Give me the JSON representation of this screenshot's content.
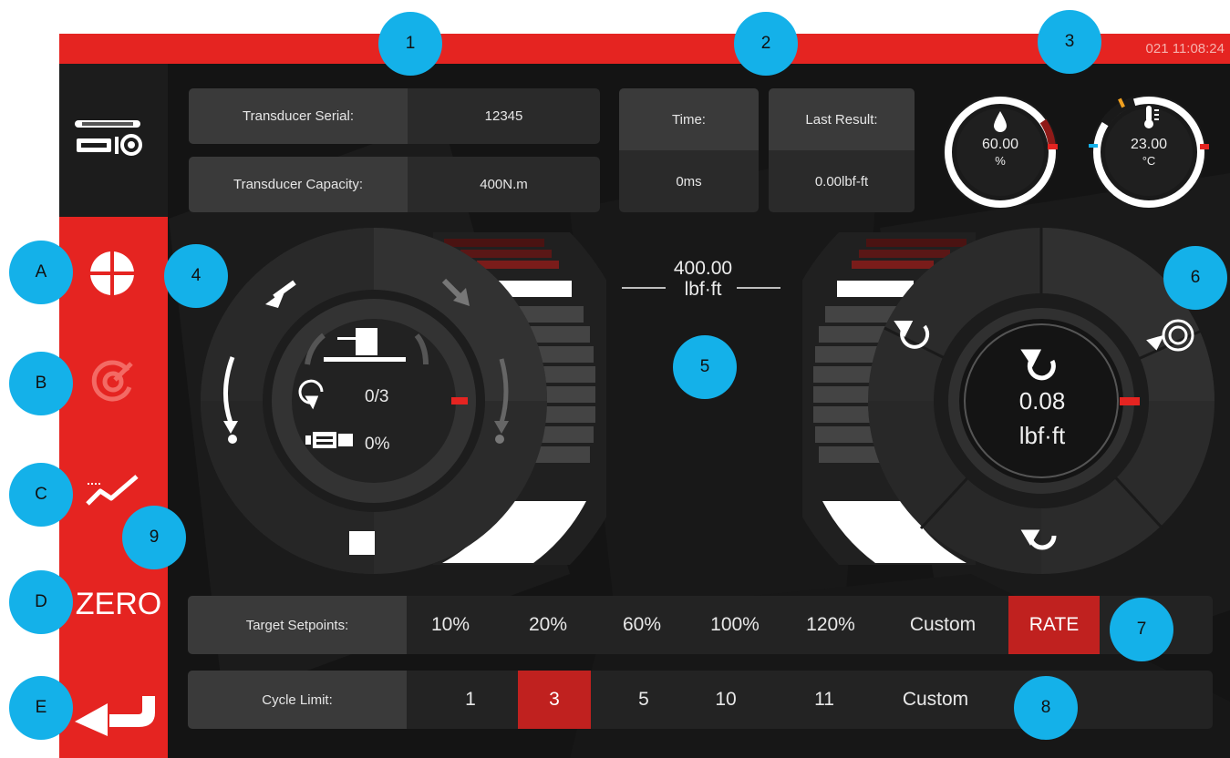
{
  "status": {
    "clock": "021 11:08:24"
  },
  "info": {
    "serial_label": "Transducer Serial:",
    "serial_value": "12345",
    "capacity_label": "Transducer Capacity:",
    "capacity_value": "400N.m",
    "time_label": "Time:",
    "time_value": "0ms",
    "last_result_label": "Last Result:",
    "last_result_value": "0.00lbf-ft"
  },
  "gauges": {
    "humidity": {
      "value": "60.00",
      "unit": "%",
      "icon": "droplet-icon"
    },
    "temperature": {
      "value": "23.00",
      "unit": "°C",
      "icon": "thermometer-icon"
    }
  },
  "left_dial": {
    "cycle_count": "0/3",
    "motor_percent": "0%"
  },
  "scale": {
    "max_value": "400.00",
    "max_unit": "lbf·ft"
  },
  "right_dial": {
    "value": "0.08",
    "unit": "lbf·ft"
  },
  "sidebar": {
    "items": [
      {
        "name": "crosshair-icon"
      },
      {
        "name": "target-icon"
      },
      {
        "name": "graph-icon"
      },
      {
        "label": "ZERO"
      },
      {
        "name": "return-icon"
      }
    ]
  },
  "target_setpoints": {
    "label": "Target Setpoints:",
    "options": [
      "10%",
      "20%",
      "60%",
      "100%",
      "120%",
      "Custom",
      "RATE"
    ],
    "active": "RATE"
  },
  "cycle_limit": {
    "label": "Cycle Limit:",
    "options": [
      "1",
      "3",
      "5",
      "10",
      "11",
      "Custom"
    ],
    "active": "3"
  },
  "callouts": [
    "1",
    "2",
    "3",
    "4",
    "5",
    "6",
    "7",
    "8",
    "9",
    "A",
    "B",
    "C",
    "D",
    "E"
  ],
  "colors": {
    "accent_red": "#e52421",
    "callout_blue": "#14b1e9",
    "background": "#141414"
  }
}
